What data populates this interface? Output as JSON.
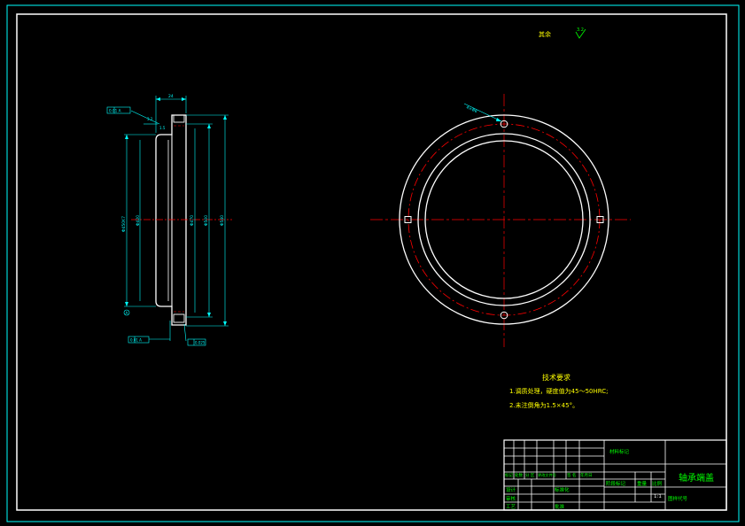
{
  "drawing": {
    "title": "轴承端盖",
    "drawing_code_label": "图样代号",
    "surface_note": {
      "label": "其余",
      "value": "3.2"
    },
    "tech": {
      "heading": "技术要求",
      "items": [
        "1.调质处理，硬度值为45～50HRC;",
        "2.未注倒角为1.5×45°。"
      ]
    },
    "title_block": {
      "material_label": "材料标记",
      "stage_label": "阶段标记",
      "weight_label": "重量",
      "scale_label": "比例",
      "scale_value": "1:1",
      "rev_labels": [
        "标记",
        "处数",
        "分 区",
        "更改文件号",
        "签 名",
        "年月日"
      ],
      "design_label": "设计",
      "standard_label": "标准化",
      "review_label": "审核",
      "process_label": "工艺",
      "approve_label": "批准"
    },
    "dims": {
      "width_top": "24",
      "ref_box": "0.01 A",
      "dia_left": "Φ450K7",
      "dia_inner": "Φ420",
      "dia_mid": "Φ470",
      "dia_r1": "Φ500",
      "dia_r2": "Φ540",
      "tol_bottom_left": "0.01 A",
      "tol_bottom_right": "0.025",
      "hole_note": "4×Φ6",
      "ra_left": "3.2",
      "chamfer": "1.5",
      "datum": "A"
    }
  }
}
